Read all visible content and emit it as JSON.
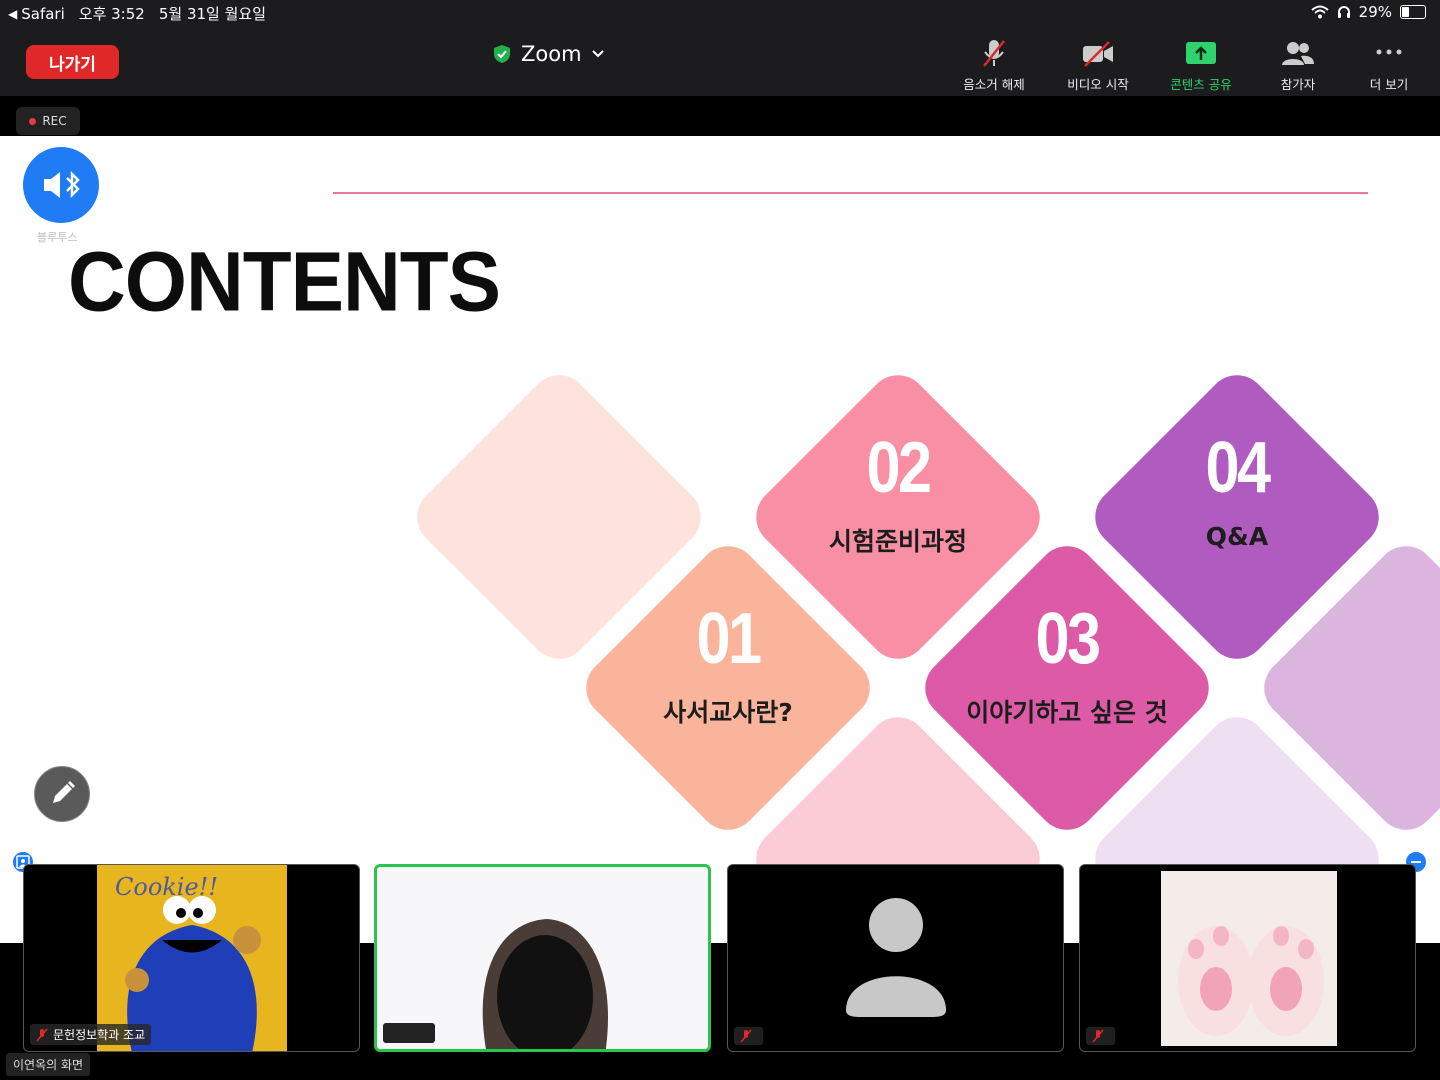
{
  "status_bar": {
    "back_app": "Safari",
    "time": "오후 3:52",
    "date": "5월 31일 월요일",
    "battery": "29%",
    "battery_level": 0.29
  },
  "toolbar": {
    "leave_label": "나가기",
    "app_title": "Zoom",
    "buttons": [
      {
        "label": "음소거 해제",
        "icon": "mic-off-icon"
      },
      {
        "label": "비디오 시작",
        "icon": "video-off-icon"
      },
      {
        "label": "콘텐츠 공유",
        "icon": "share-screen-icon"
      },
      {
        "label": "참가자",
        "icon": "participants-icon"
      },
      {
        "label": "더 보기",
        "icon": "more-icon"
      }
    ],
    "accent": "#2fd26c",
    "leave_color": "#e02828"
  },
  "rec_label": "REC",
  "audio": {
    "label": "블루투스",
    "color": "#1f7cf4"
  },
  "slide": {
    "title": "CONTENTS",
    "items": [
      {
        "num": "01",
        "text": "사서교사란?",
        "color": "#fbb49c"
      },
      {
        "num": "02",
        "text": "시험준비과정",
        "color": "#f98fa5"
      },
      {
        "num": "03",
        "text": "이야기하고 싶은 것",
        "color": "#dd5aa7"
      },
      {
        "num": "04",
        "text": "Q&A",
        "color": "#b05bc0"
      }
    ]
  },
  "participants": [
    {
      "name": "문헌정보학과 조교",
      "muted": true
    },
    {
      "name": "",
      "muted": false
    },
    {
      "name": "",
      "muted": true
    },
    {
      "name": "",
      "muted": true
    }
  ],
  "screen_owner": "이연옥의 화면"
}
